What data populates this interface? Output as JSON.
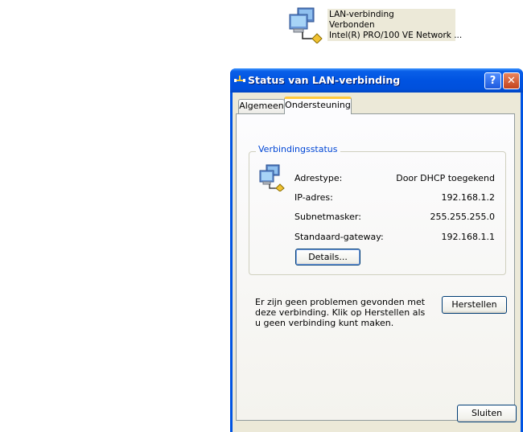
{
  "connection_item": {
    "name": "LAN-verbinding",
    "status": "Verbonden",
    "adapter": "Intel(R) PRO/100 VE Network ..."
  },
  "dialog": {
    "title": "Status van LAN-verbinding",
    "help_button": "?",
    "close_button": "✕",
    "tabs": [
      {
        "label": "Algemeen",
        "active": false
      },
      {
        "label": "Ondersteuning",
        "active": true
      }
    ],
    "group_title": "Verbindingsstatus",
    "rows": [
      {
        "label": "Adrestype:",
        "value": "Door DHCP toegekend"
      },
      {
        "label": "IP-adres:",
        "value": "192.168.1.2"
      },
      {
        "label": "Subnetmasker:",
        "value": "255.255.255.0"
      },
      {
        "label": "Standaard-gateway:",
        "value": "192.168.1.1"
      }
    ],
    "details_button": "Details...",
    "info_text": "Er zijn geen problemen gevonden met deze verbinding. Klik op Herstellen als u geen verbinding kunt maken.",
    "repair_button": "Herstellen",
    "close_dialog_button": "Sluiten"
  },
  "icons": {
    "connection": "network-connection-icon",
    "title": "network-plug-icon",
    "status": "network-computers-icon"
  },
  "colors": {
    "titlebar": "#0053e1",
    "client": "#ece9d8",
    "group_label": "#0046d5",
    "close_red": "#c3431e",
    "active_tab_accent": "#ffc83c"
  }
}
